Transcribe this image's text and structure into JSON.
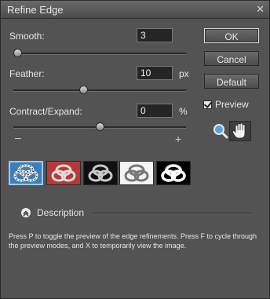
{
  "window": {
    "title": "Refine Edge",
    "close_icon": "close-icon"
  },
  "smooth": {
    "label": "Smooth:",
    "value": "3",
    "slider": 0.0
  },
  "feather": {
    "label": "Feather:",
    "value": "10",
    "unit": "px",
    "slider": 0.4
  },
  "contract": {
    "label": "Contract/Expand:",
    "value": "0",
    "unit": "%",
    "slider": 0.5,
    "minus": "–",
    "plus": "+"
  },
  "buttons": {
    "ok": "OK",
    "cancel": "Cancel",
    "default": "Default"
  },
  "preview": {
    "label": "Preview",
    "checked": true
  },
  "tools": {
    "zoom": "zoom-tool-icon",
    "hand": "hand-tool-icon"
  },
  "view_modes": [
    {
      "name": "marching-ants",
      "selected": true
    },
    {
      "name": "overlay-red",
      "selected": false
    },
    {
      "name": "on-black",
      "selected": false
    },
    {
      "name": "on-white",
      "selected": false
    },
    {
      "name": "mask",
      "selected": false
    }
  ],
  "description": {
    "label": "Description",
    "text": "Press P to toggle the preview of the edge refinements. Press F to cycle through the preview modes, and X to temporarily view the image."
  },
  "colors": {
    "dialog_bg": "#535353",
    "field_bg": "#252525",
    "overlay_red": "#b23a3a"
  }
}
